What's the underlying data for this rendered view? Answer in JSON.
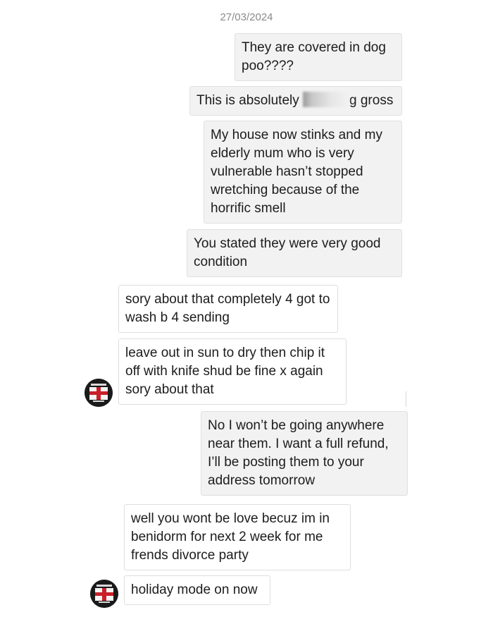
{
  "chat": {
    "date": "27/03/2024",
    "messages": [
      {
        "from": "me",
        "text": "They are covered in dog poo????"
      },
      {
        "from": "me",
        "text_before": "This is absolutely",
        "text_after": "g gross",
        "redacted": true
      },
      {
        "from": "me",
        "text": "My house now stinks and my elderly mum who is very vulnerable hasn’t stopped wretching because of the horrific smell"
      },
      {
        "from": "me",
        "text": "You stated they were very good condition"
      },
      {
        "from": "them",
        "text": "sory about that completely 4 got to wash b 4 sending"
      },
      {
        "from": "them",
        "text": "leave out in sun to dry then chip it off with knife shud be fine x again sory about that"
      },
      {
        "from": "me",
        "text": "No I won’t be going anywhere near them. I want a full refund, I’ll be posting them to your address tomorrow"
      },
      {
        "from": "them",
        "text": "well you wont be love becuz im in benidorm for next 2 week for me frends divorce party"
      },
      {
        "from": "them",
        "text": "holiday mode on now"
      }
    ]
  },
  "avatar": {
    "icon": "england-flag-avatar-icon",
    "colors": {
      "bg": "#1a1a1a",
      "flag_white": "#f4f4f4",
      "cross": "#c8202a"
    }
  }
}
